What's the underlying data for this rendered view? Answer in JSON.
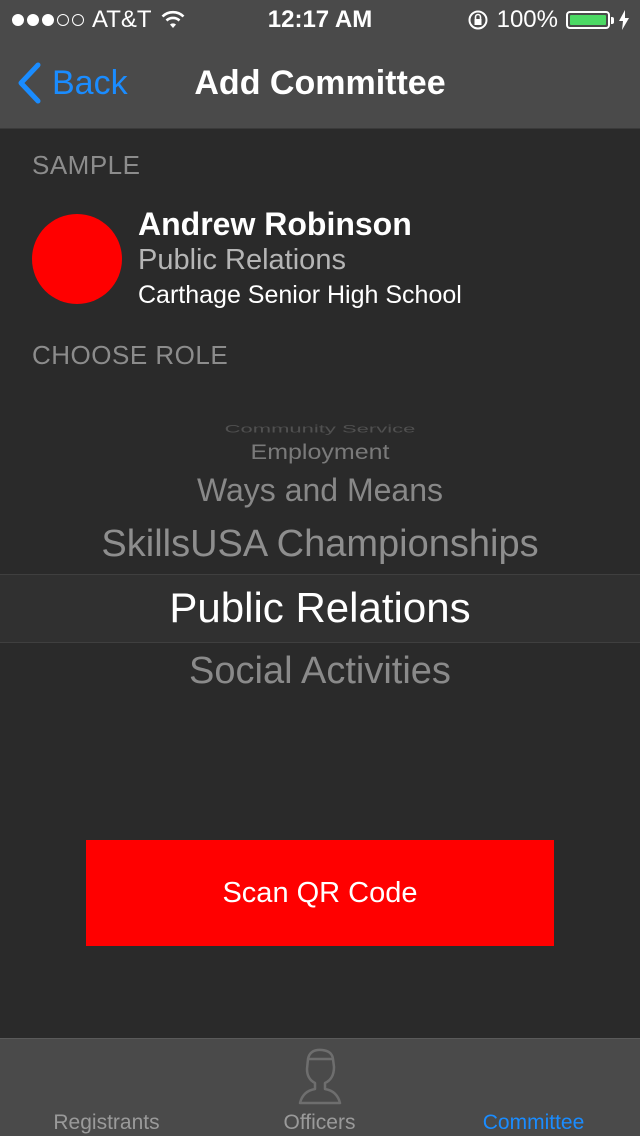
{
  "status_bar": {
    "carrier": "AT&T",
    "time": "12:17 AM",
    "battery_percent": "100%",
    "signal_bars_filled": 3,
    "signal_bars_total": 5
  },
  "nav": {
    "back_label": "Back",
    "title": "Add Committee"
  },
  "sample": {
    "section_label": "SAMPLE",
    "name": "Andrew Robinson",
    "role": "Public Relations",
    "school": "Carthage Senior High School",
    "avatar_color": "#ff0000"
  },
  "role_picker": {
    "section_label": "CHOOSE ROLE",
    "options": [
      "Community Service",
      "Employment",
      "Ways and Means",
      "SkillsUSA Championships",
      "Public Relations",
      "Social Activities"
    ],
    "selected": "Public Relations"
  },
  "scan_button": {
    "label": "Scan QR Code",
    "color": "#ff0000"
  },
  "tab_bar": {
    "tabs": [
      {
        "label": "Registrants",
        "icon": "registrants-icon",
        "active": false
      },
      {
        "label": "Officers",
        "icon": "officers-icon",
        "active": false
      },
      {
        "label": "Committee",
        "icon": "committee-icon",
        "active": true
      }
    ],
    "active_color": "#1a8cff"
  }
}
